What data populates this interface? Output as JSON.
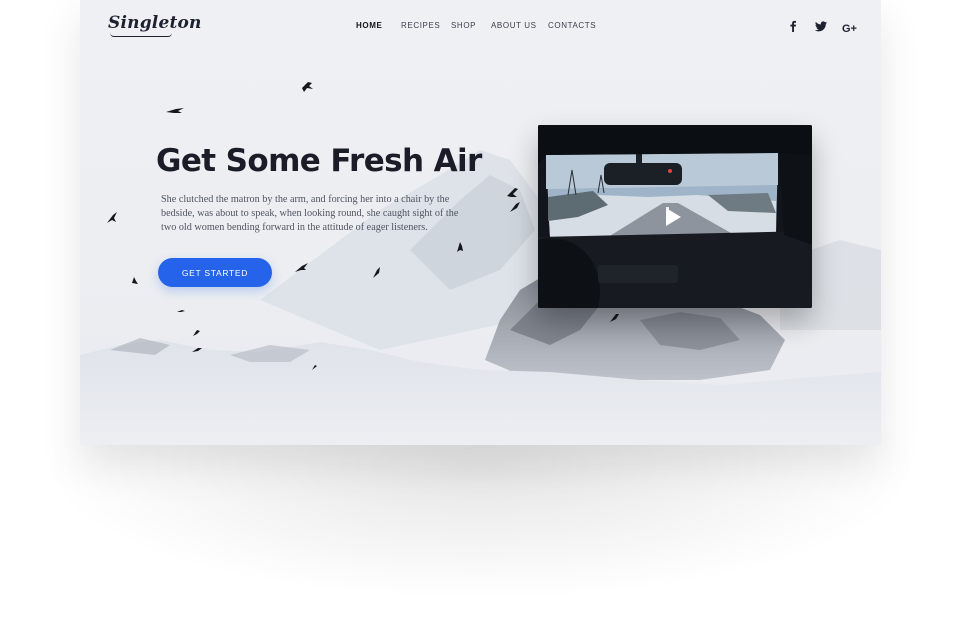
{
  "brand": {
    "logo_text": "Singleton"
  },
  "nav": {
    "items": [
      {
        "label": "HOME",
        "active": true
      },
      {
        "label": "RECIPES",
        "active": false
      },
      {
        "label": "SHOP",
        "active": false
      },
      {
        "label": "ABOUT US",
        "active": false
      },
      {
        "label": "CONTACTS",
        "active": false
      }
    ]
  },
  "social": {
    "icons": [
      "facebook-icon",
      "twitter-icon",
      "google-plus-icon"
    ],
    "google_plus_label": "G+"
  },
  "hero": {
    "title": "Get Some Fresh Air",
    "body": "She clutched the matron by the arm, and forcing her into a chair by the bedside, was about to speak, when looking round, she caught sight of the two old women bending forward in the attitude of eager listeners.",
    "cta_label": "GET STARTED"
  },
  "video": {
    "icon": "play-icon"
  },
  "colors": {
    "accent": "#2563eb",
    "heading": "#1a1d27",
    "background": "#eceef2",
    "video_bg": "#0f1217"
  }
}
